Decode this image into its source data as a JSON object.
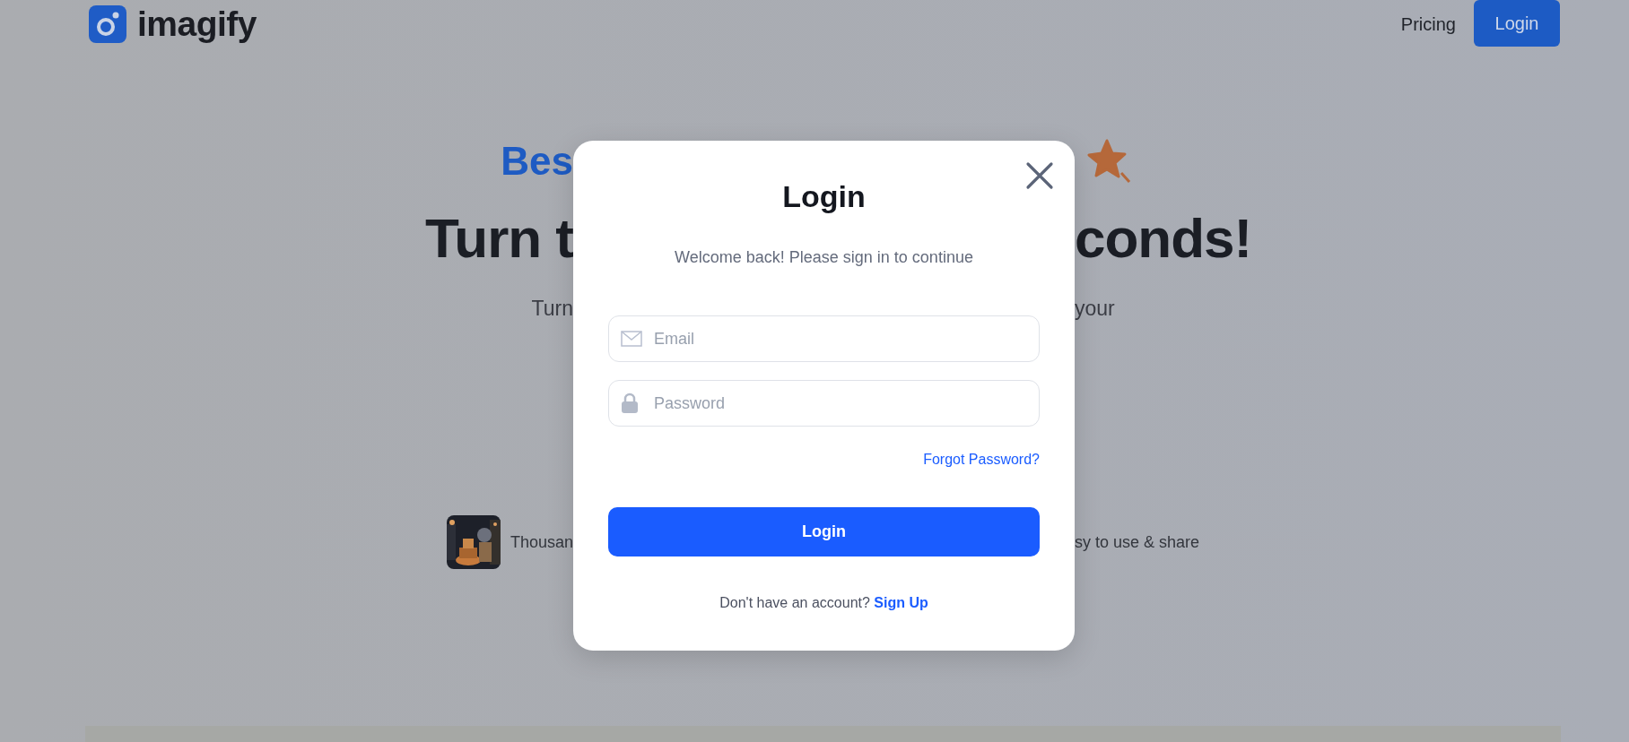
{
  "header": {
    "logo_text": "imagify",
    "nav_links": [
      {
        "label": "Pricing"
      }
    ],
    "login_button": "Login"
  },
  "hero": {
    "badge_fragment": "Bes",
    "headline_left": "Turn t",
    "headline_right": "conds!",
    "subtitle_left": "Turn",
    "subtitle_right": "your",
    "review_left": "Thousan",
    "review_right": "sy to use & share"
  },
  "modal": {
    "title": "Login",
    "subtitle": "Welcome back! Please sign in to continue",
    "fields": [
      {
        "kind": "email",
        "placeholder": "Email"
      },
      {
        "kind": "password",
        "placeholder": "Password"
      }
    ],
    "forgot_link": "Forgot Password?",
    "submit": "Login",
    "footer_text": "Don't have an account?",
    "footer_link": "Sign Up"
  }
}
